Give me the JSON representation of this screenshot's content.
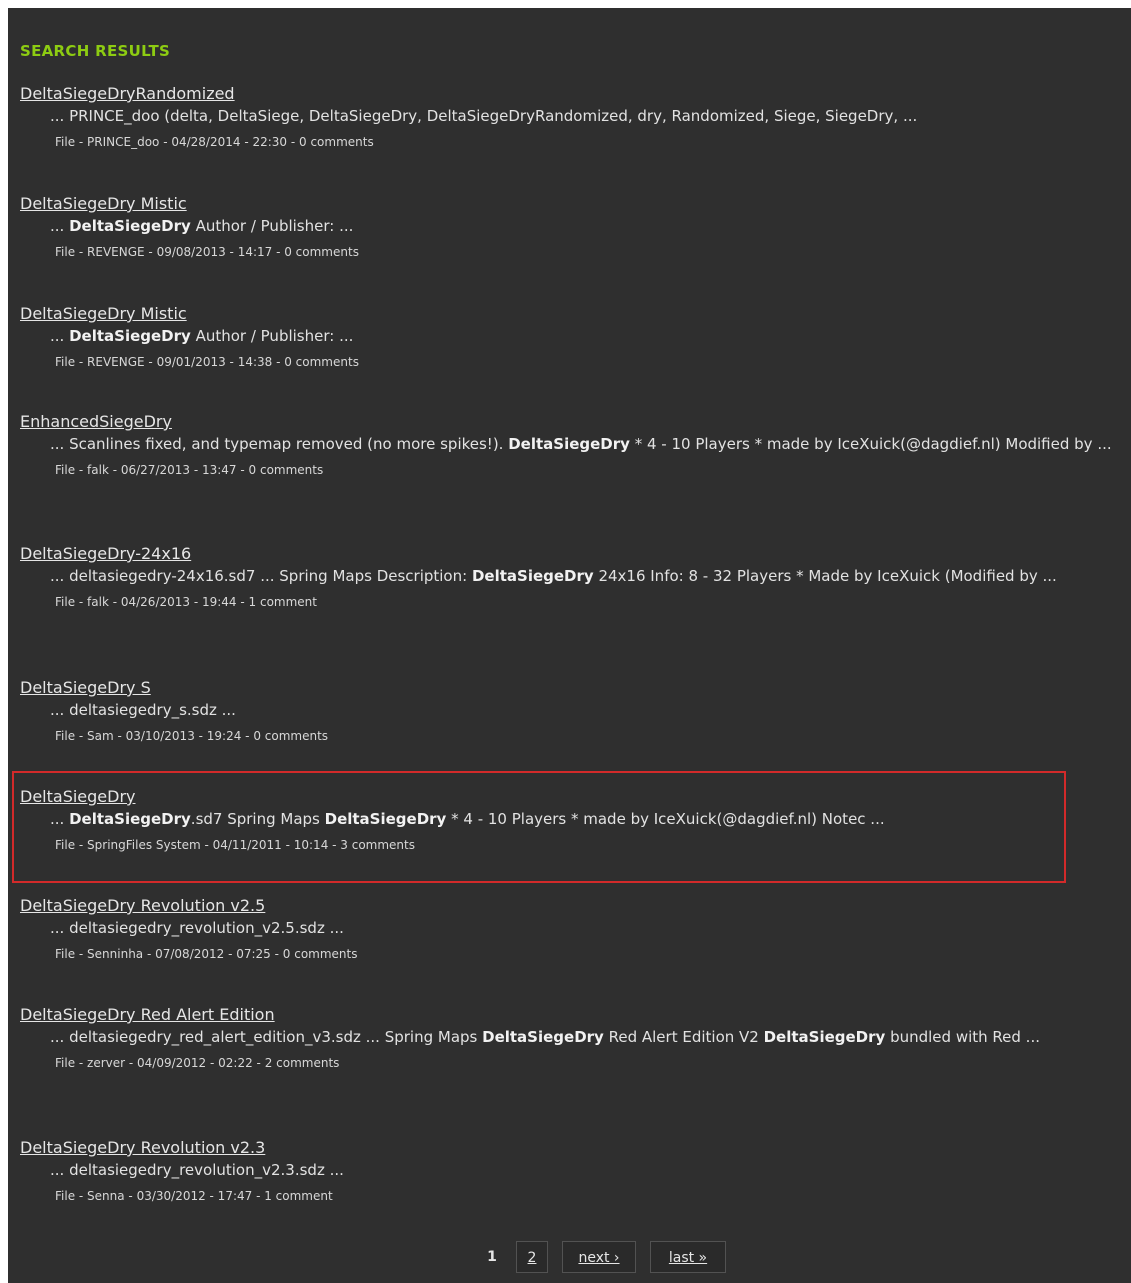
{
  "heading": "SEARCH RESULTS",
  "results": [
    {
      "title": "DeltaSiegeDryRandomized",
      "snippet_parts": [
        {
          "t": "... PRINCE_doo (delta, DeltaSiege, DeltaSiegeDry, DeltaSiegeDryRandomized, dry, Randomized, Siege, SiegeDry, ...",
          "b": false
        }
      ],
      "meta": "File - PRINCE_doo - 04/28/2014 - 22:30 - 0 comments"
    },
    {
      "title": "DeltaSiegeDry Mistic",
      "snippet_parts": [
        {
          "t": "... ",
          "b": false
        },
        {
          "t": "DeltaSiegeDry",
          "b": true
        },
        {
          "t": " Author / Publisher: ...",
          "b": false
        }
      ],
      "meta": "File - REVENGE - 09/08/2013 - 14:17 - 0 comments"
    },
    {
      "title": "DeltaSiegeDry Mistic",
      "snippet_parts": [
        {
          "t": "... ",
          "b": false
        },
        {
          "t": "DeltaSiegeDry",
          "b": true
        },
        {
          "t": " Author / Publisher: ...",
          "b": false
        }
      ],
      "meta": "File - REVENGE - 09/01/2013 - 14:38 - 0 comments"
    },
    {
      "title": "EnhancedSiegeDry",
      "snippet_parts": [
        {
          "t": "... Scanlines fixed, and typemap removed (no more spikes!). ",
          "b": false
        },
        {
          "t": "DeltaSiegeDry",
          "b": true
        },
        {
          "t": " * 4 - 10 Players * made by IceXuick(@dagdief.nl) Modified by ...",
          "b": false
        }
      ],
      "meta": "File - falk - 06/27/2013 - 13:47 - 0 comments"
    },
    {
      "title": "DeltaSiegeDry-24x16",
      "snippet_parts": [
        {
          "t": "... deltasiegedry-24x16.sd7 ... Spring Maps Description: ",
          "b": false
        },
        {
          "t": "DeltaSiegeDry",
          "b": true
        },
        {
          "t": " 24x16 Info: 8 - 32 Players * Made by IceXuick (Modified by ...",
          "b": false
        }
      ],
      "meta": "File - falk - 04/26/2013 - 19:44 - 1 comment"
    },
    {
      "title": "DeltaSiegeDry S",
      "snippet_parts": [
        {
          "t": "... deltasiegedry_s.sdz ...",
          "b": false
        }
      ],
      "meta": "File - Sam - 03/10/2013 - 19:24 - 0 comments"
    },
    {
      "title": "DeltaSiegeDry",
      "snippet_parts": [
        {
          "t": "... ",
          "b": false
        },
        {
          "t": "DeltaSiegeDry",
          "b": true
        },
        {
          "t": ".sd7 Spring Maps ",
          "b": false
        },
        {
          "t": "DeltaSiegeDry",
          "b": true
        },
        {
          "t": " * 4 - 10 Players * made by IceXuick(@dagdief.nl) Notec ...",
          "b": false
        }
      ],
      "meta": "File - SpringFiles System - 04/11/2011 - 10:14 - 3 comments"
    },
    {
      "title": "DeltaSiegeDry Revolution v2.5",
      "snippet_parts": [
        {
          "t": "... deltasiegedry_revolution_v2.5.sdz ...",
          "b": false
        }
      ],
      "meta": "File - Senninha - 07/08/2012 - 07:25 - 0 comments"
    },
    {
      "title": "DeltaSiegeDry Red Alert Edition",
      "snippet_parts": [
        {
          "t": "... deltasiegedry_red_alert_edition_v3.sdz ... Spring Maps ",
          "b": false
        },
        {
          "t": "DeltaSiegeDry",
          "b": true
        },
        {
          "t": " Red Alert Edition V2 ",
          "b": false
        },
        {
          "t": "DeltaSiegeDry",
          "b": true
        },
        {
          "t": " bundled with Red ...",
          "b": false
        }
      ],
      "meta": "File - zerver - 04/09/2012 - 02:22 - 2 comments"
    },
    {
      "title": "DeltaSiegeDry Revolution v2.3",
      "snippet_parts": [
        {
          "t": "... deltasiegedry_revolution_v2.3.sdz ...",
          "b": false
        }
      ],
      "meta": "File - Senna - 03/30/2012 - 17:47 - 1 comment"
    }
  ],
  "pagination": {
    "current": "1",
    "page2": "2",
    "next": "next ›",
    "last": "last »"
  }
}
